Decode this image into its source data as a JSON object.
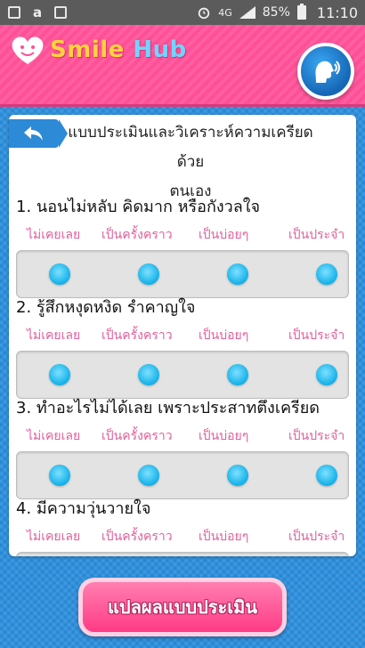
{
  "status_bar": {
    "icons_left": [
      "photo-icon",
      "amazon-icon",
      "bag-icon"
    ],
    "alarm_icon": "alarm-icon",
    "network": "4G",
    "battery": "85%",
    "time": "11:10"
  },
  "header": {
    "logo": "Smile Hub",
    "voice_icon": "speaking-head-icon",
    "colors": {
      "pink": "#ff4f96",
      "blue": "#1f7bc4"
    }
  },
  "card": {
    "title_line1": "แบบประเมินและวิเคราะห์ความเครียดด้วย",
    "title_line2": "ตนเอง",
    "options": [
      "ไม่เคยเลย",
      "เป็นครั้งคราว",
      "เป็นบ่อยๆ",
      "เป็นประจำ"
    ],
    "questions": [
      {
        "text": "1. นอนไม่หลับ คิดมาก หรือกังวลใจ"
      },
      {
        "text": "2. รู้สึกหงุดหงิด รำคาญใจ"
      },
      {
        "text": "3. ทำอะไรไม่ได้เลย เพราะประสาทตึงเครียด"
      },
      {
        "text": "4. มีความวุ่นวายใจ"
      }
    ]
  },
  "submit_label": "แปลผลแบบประเมิน"
}
